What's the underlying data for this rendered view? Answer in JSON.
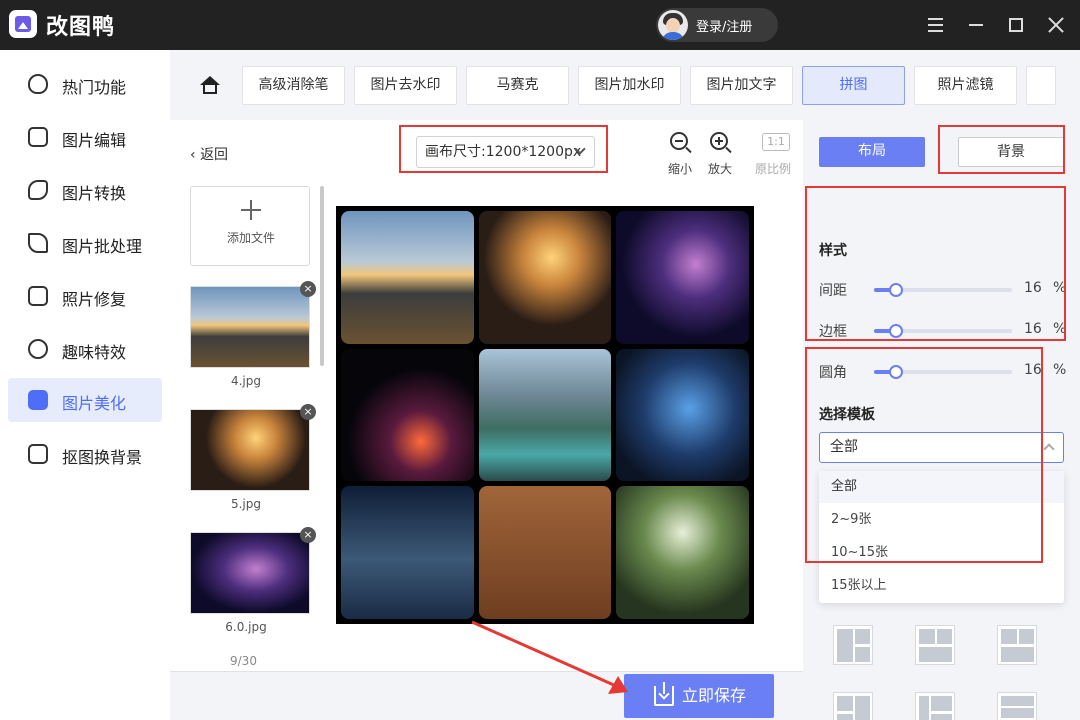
{
  "app": {
    "title": "改图鸭",
    "login_label": "登录/注册"
  },
  "nav": {
    "items": [
      {
        "label": "热门功能",
        "icon": "flame-icon"
      },
      {
        "label": "图片编辑",
        "icon": "image-edit-icon"
      },
      {
        "label": "图片转换",
        "icon": "convert-icon"
      },
      {
        "label": "图片批处理",
        "icon": "batch-icon"
      },
      {
        "label": "照片修复",
        "icon": "repair-icon"
      },
      {
        "label": "趣味特效",
        "icon": "magic-icon"
      },
      {
        "label": "图片美化",
        "icon": "beautify-icon",
        "active": true
      },
      {
        "label": "抠图换背景",
        "icon": "cutout-icon"
      }
    ]
  },
  "tools": [
    "高级消除笔",
    "图片去水印",
    "马赛克",
    "图片加水印",
    "图片加文字",
    "拼图",
    "照片滤镜"
  ],
  "active_tool": "拼图",
  "workspace": {
    "back_label": "返回",
    "canvas_size": "画布尺寸:1200*1200px",
    "zoom_out_label": "缩小",
    "zoom_in_label": "放大",
    "ratio_label": "原比例",
    "ratio_box": "1:1",
    "add_file_label": "添加文件",
    "files": [
      "4.jpg",
      "5.jpg",
      "6.0.jpg"
    ],
    "page_count": "9/30"
  },
  "save_label": "立即保存",
  "panel": {
    "layout_tab": "布局",
    "background_tab": "背景",
    "style_title": "样式",
    "sliders": [
      {
        "label": "间距",
        "value": "16",
        "unit": "%"
      },
      {
        "label": "边框",
        "value": "16",
        "unit": "%"
      },
      {
        "label": "圆角",
        "value": "16",
        "unit": "%"
      }
    ],
    "template_title": "选择模板",
    "template_selected": "全部",
    "template_options": [
      "全部",
      "2~9张",
      "10~15张",
      "15张以上"
    ]
  },
  "colors": {
    "accent": "#6b7ff5",
    "highlight": "#e53935",
    "titlebar": "#222222"
  }
}
